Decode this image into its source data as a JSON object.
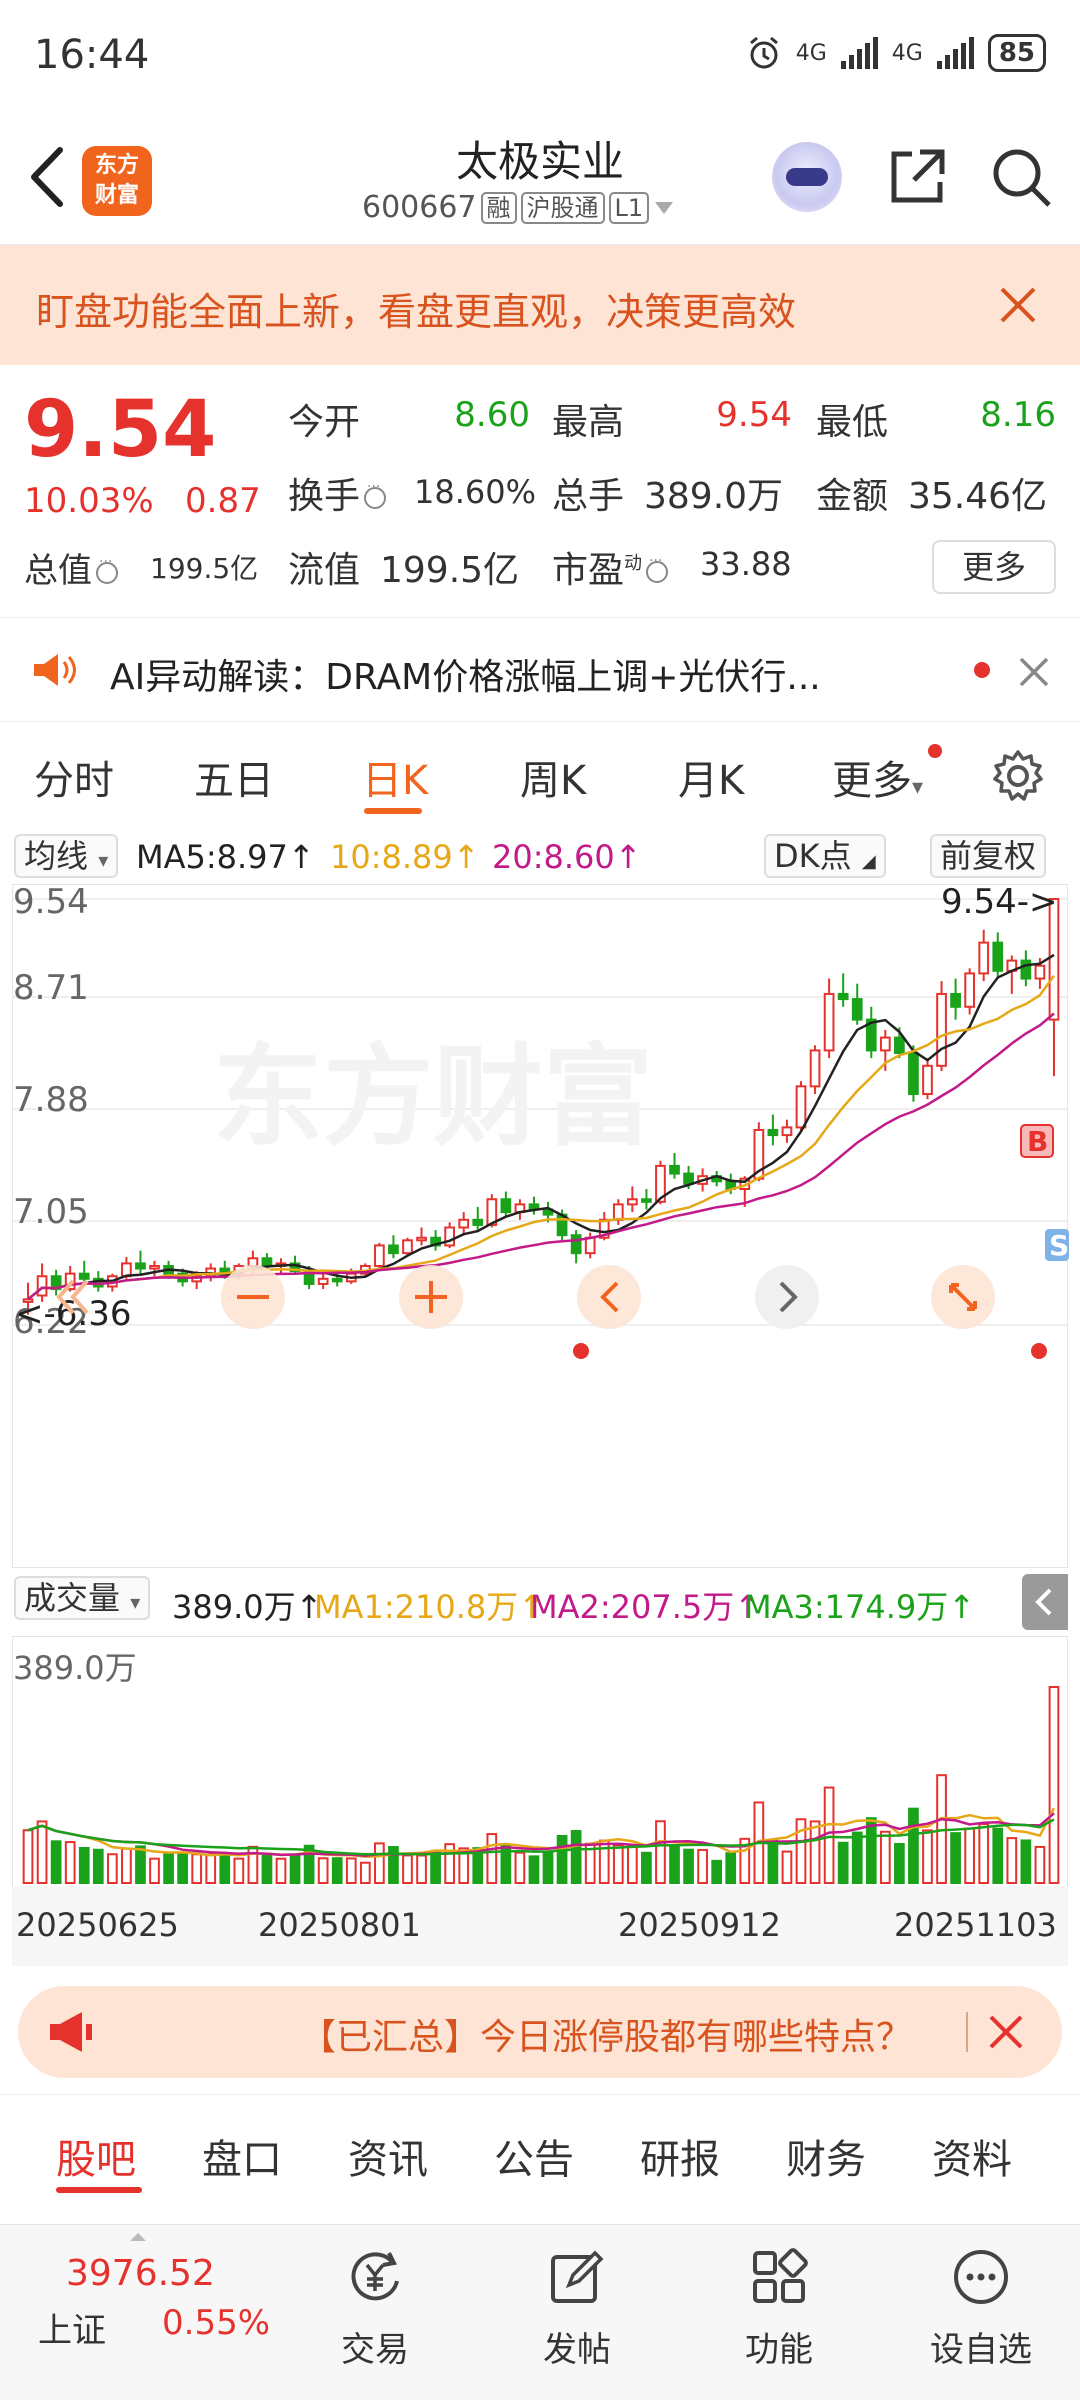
{
  "status_bar": {
    "time": "16:44",
    "net1": "4G",
    "net2": "4G",
    "battery": "85"
  },
  "header": {
    "title": "太极实业",
    "code": "600667",
    "tags": [
      "融",
      "沪股通",
      "L1"
    ],
    "logo_text": [
      "东方",
      "财富"
    ]
  },
  "banner": {
    "text": "盯盘功能全面上新，看盘更直观，决策更高效"
  },
  "quote": {
    "price": "9.54",
    "change_pct": "10.03%",
    "change_val": "0.87",
    "total_value_label": "总值",
    "total_value": "199.5亿",
    "open_label": "今开",
    "open": "8.60",
    "high_label": "最高",
    "high": "9.54",
    "low_label": "最低",
    "low": "8.16",
    "turnover_label": "换手",
    "turnover": "18.60%",
    "volume_label": "总手",
    "volume": "389.0万",
    "amount_label": "金额",
    "amount": "35.46亿",
    "float_label": "流值",
    "float_value": "199.5亿",
    "pe_label": "市盈",
    "pe_sup": "动",
    "pe": "33.88",
    "more": "更多"
  },
  "ai_bar": {
    "text": "AI异动解读：DRAM价格涨幅上调+光伏行..."
  },
  "tabs": [
    "分时",
    "五日",
    "日K",
    "周K",
    "月K",
    "更多"
  ],
  "ma_row": {
    "selector": "均线",
    "ma5": "MA5:8.97↑",
    "ma10": "10:8.89↑",
    "ma20": "20:8.60↑",
    "dk": "DK点",
    "adjust": "前复权"
  },
  "kline": {
    "y_labels": [
      "9.54",
      "8.71",
      "7.88",
      "7.05",
      "6.22"
    ],
    "high_marker": "9.54->",
    "low_marker": "<-6.36",
    "watermark": "东方财富",
    "marker_b": "B",
    "marker_s": "S"
  },
  "volume": {
    "selector": "成交量",
    "value": "389.0万↑",
    "ma1": "MA1:210.8万↑",
    "ma2": "MA2:207.5万↑",
    "ma3": "MA3:174.9万↑",
    "max_label": "389.0万"
  },
  "dates": [
    "20250625",
    "20250801",
    "20250912",
    "20251103"
  ],
  "ticker": {
    "text": "【已汇总】今日涨停股都有哪些特点？"
  },
  "sub_tabs": [
    "股吧",
    "盘口",
    "资讯",
    "公告",
    "研报",
    "财务",
    "资料"
  ],
  "bottom_bar": {
    "index_value": "3976.52",
    "index_name": "上证",
    "index_pct": "0.55%",
    "nav": [
      "交易",
      "发帖",
      "功能",
      "设自选"
    ]
  },
  "colors": {
    "up": "#e5322d",
    "down": "#1aa21a",
    "accent": "#f0641e",
    "ma5": "#222222",
    "ma10": "#e6a817",
    "ma20": "#c21a8a"
  },
  "chart_data": {
    "type": "candlestick",
    "ylim": [
      6.22,
      9.54
    ],
    "candles": [
      [
        6.4,
        6.55,
        6.3,
        6.42
      ],
      [
        6.45,
        6.7,
        6.4,
        6.6
      ],
      [
        6.6,
        6.65,
        6.45,
        6.5
      ],
      [
        6.5,
        6.68,
        6.48,
        6.62
      ],
      [
        6.62,
        6.72,
        6.55,
        6.58
      ],
      [
        6.58,
        6.64,
        6.48,
        6.52
      ],
      [
        6.52,
        6.62,
        6.48,
        6.6
      ],
      [
        6.6,
        6.75,
        6.58,
        6.7
      ],
      [
        6.7,
        6.8,
        6.62,
        6.66
      ],
      [
        6.66,
        6.72,
        6.6,
        6.68
      ],
      [
        6.68,
        6.72,
        6.58,
        6.62
      ],
      [
        6.62,
        6.66,
        6.52,
        6.56
      ],
      [
        6.56,
        6.64,
        6.5,
        6.6
      ],
      [
        6.6,
        6.7,
        6.56,
        6.66
      ],
      [
        6.66,
        6.72,
        6.58,
        6.62
      ],
      [
        6.62,
        6.7,
        6.58,
        6.68
      ],
      [
        6.68,
        6.8,
        6.62,
        6.74
      ],
      [
        6.74,
        6.78,
        6.64,
        6.68
      ],
      [
        6.68,
        6.74,
        6.62,
        6.7
      ],
      [
        6.7,
        6.76,
        6.62,
        6.64
      ],
      [
        6.64,
        6.68,
        6.5,
        6.54
      ],
      [
        6.54,
        6.62,
        6.5,
        6.58
      ],
      [
        6.58,
        6.64,
        6.52,
        6.56
      ],
      [
        6.56,
        6.66,
        6.54,
        6.62
      ],
      [
        6.62,
        6.7,
        6.6,
        6.68
      ],
      [
        6.68,
        6.86,
        6.66,
        6.84
      ],
      [
        6.84,
        6.92,
        6.74,
        6.78
      ],
      [
        6.78,
        6.9,
        6.76,
        6.88
      ],
      [
        6.88,
        6.98,
        6.84,
        6.9
      ],
      [
        6.9,
        6.96,
        6.8,
        6.84
      ],
      [
        6.84,
        7.02,
        6.82,
        6.98
      ],
      [
        6.98,
        7.1,
        6.92,
        7.04
      ],
      [
        7.04,
        7.14,
        6.96,
        7.0
      ],
      [
        7.0,
        7.24,
        6.98,
        7.2
      ],
      [
        7.2,
        7.26,
        7.06,
        7.1
      ],
      [
        7.1,
        7.2,
        7.04,
        7.16
      ],
      [
        7.16,
        7.22,
        7.08,
        7.12
      ],
      [
        7.12,
        7.18,
        7.02,
        7.08
      ],
      [
        7.08,
        7.12,
        6.88,
        6.92
      ],
      [
        6.92,
        6.96,
        6.7,
        6.78
      ],
      [
        6.78,
        6.94,
        6.74,
        6.9
      ],
      [
        6.9,
        7.1,
        6.88,
        7.04
      ],
      [
        7.04,
        7.2,
        7.0,
        7.16
      ],
      [
        7.16,
        7.3,
        7.1,
        7.2
      ],
      [
        7.2,
        7.28,
        7.12,
        7.18
      ],
      [
        7.18,
        7.5,
        7.16,
        7.46
      ],
      [
        7.46,
        7.56,
        7.36,
        7.4
      ],
      [
        7.4,
        7.46,
        7.28,
        7.32
      ],
      [
        7.32,
        7.44,
        7.26,
        7.38
      ],
      [
        7.38,
        7.42,
        7.3,
        7.34
      ],
      [
        7.34,
        7.4,
        7.24,
        7.28
      ],
      [
        7.28,
        7.38,
        7.14,
        7.36
      ],
      [
        7.36,
        7.8,
        7.34,
        7.74
      ],
      [
        7.74,
        7.86,
        7.62,
        7.7
      ],
      [
        7.7,
        7.82,
        7.64,
        7.76
      ],
      [
        7.76,
        8.12,
        7.74,
        8.08
      ],
      [
        8.08,
        8.4,
        8.02,
        8.36
      ],
      [
        8.36,
        8.92,
        8.3,
        8.8
      ],
      [
        8.8,
        8.96,
        8.7,
        8.76
      ],
      [
        8.76,
        8.88,
        8.56,
        8.6
      ],
      [
        8.6,
        8.7,
        8.3,
        8.36
      ],
      [
        8.36,
        8.52,
        8.2,
        8.46
      ],
      [
        8.46,
        8.54,
        8.3,
        8.34
      ],
      [
        8.34,
        8.4,
        7.96,
        8.02
      ],
      [
        8.02,
        8.3,
        7.98,
        8.24
      ],
      [
        8.24,
        8.9,
        8.2,
        8.8
      ],
      [
        8.8,
        8.92,
        8.6,
        8.7
      ],
      [
        8.7,
        9.0,
        8.64,
        8.96
      ],
      [
        8.96,
        9.3,
        8.9,
        9.2
      ],
      [
        9.2,
        9.28,
        8.92,
        8.98
      ],
      [
        8.98,
        9.1,
        8.8,
        9.06
      ],
      [
        9.06,
        9.14,
        8.86,
        8.92
      ],
      [
        8.92,
        9.08,
        8.84,
        9.02
      ],
      [
        8.6,
        9.54,
        8.16,
        9.54
      ]
    ]
  }
}
